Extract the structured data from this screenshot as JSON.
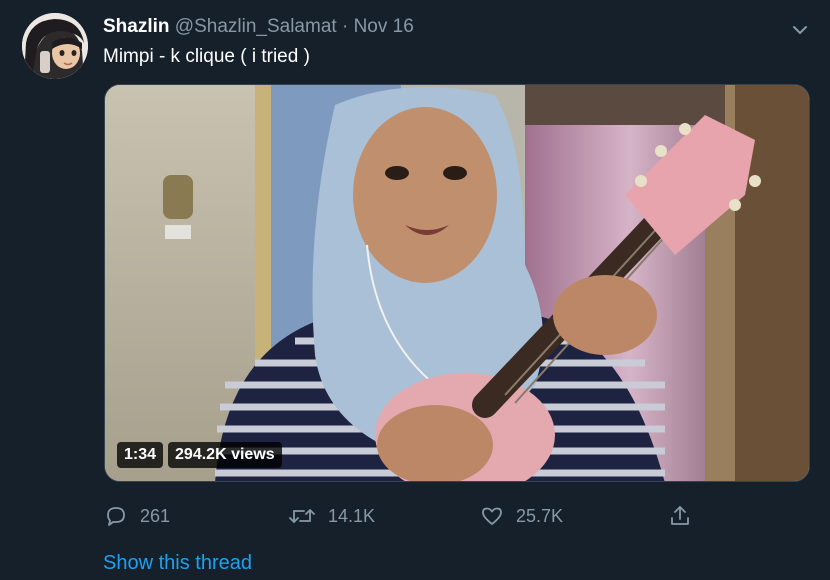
{
  "tweet": {
    "author_name": "Shazlin",
    "handle": "@Shazlin_Salamat",
    "separator": "·",
    "date": "Nov 16",
    "text": "Mimpi - k clique ( i tried )"
  },
  "video": {
    "duration": "1:34",
    "views": "294.2K views"
  },
  "actions": {
    "reply_count": "261",
    "retweet_count": "14.1K",
    "like_count": "25.7K"
  },
  "thread_link": "Show this thread",
  "icons": {
    "caret": "chevron-down-icon",
    "reply": "reply-icon",
    "retweet": "retweet-icon",
    "like": "heart-icon",
    "share": "share-icon"
  },
  "colors": {
    "background": "#15202b",
    "secondary_text": "#8899a6",
    "link": "#1da1f2",
    "border": "#38444d"
  }
}
